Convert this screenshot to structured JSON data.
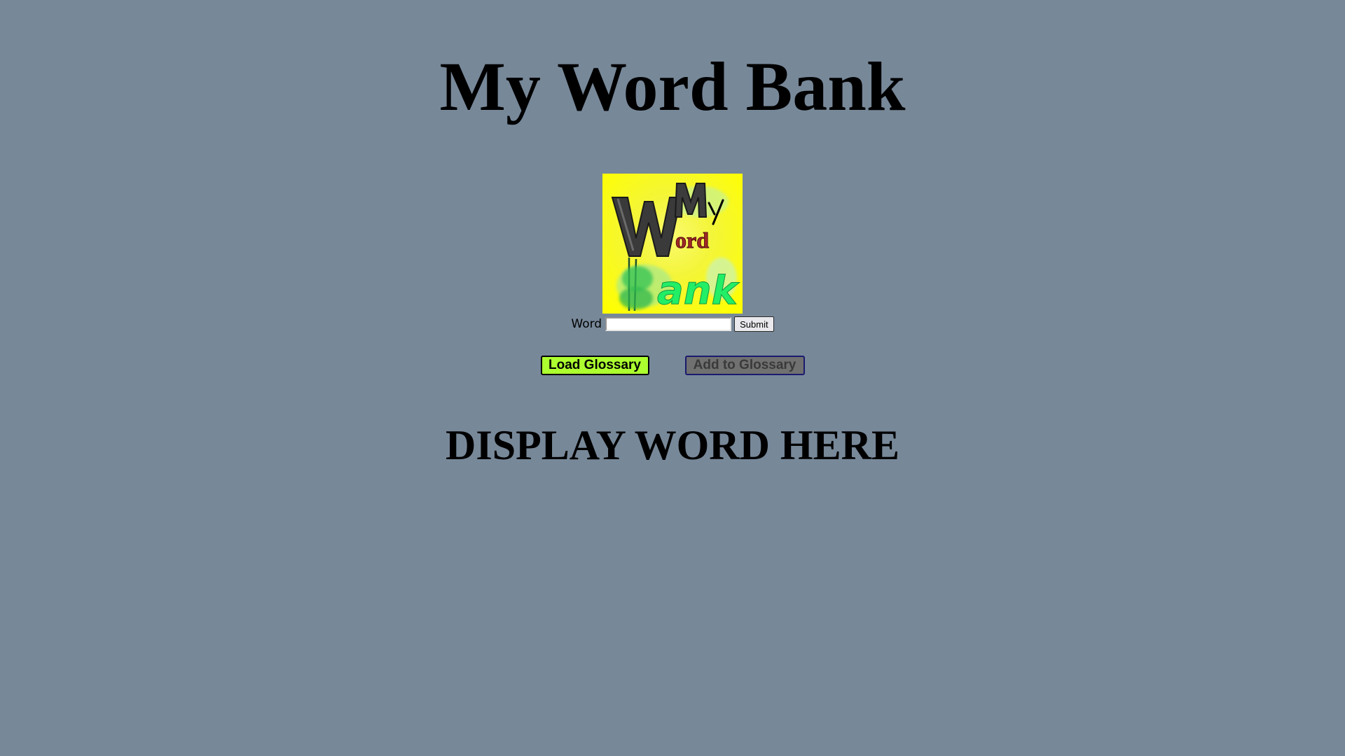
{
  "page": {
    "title": "My Word Bank",
    "background_color": "#778899"
  },
  "logo": {
    "icon": "word-bank-logo",
    "text": "My Word Bank",
    "colors": {
      "background": "#ffff22",
      "dark_letters": "#3a3a3a",
      "ord_letters": "#a02828",
      "bank_letters": "#22ee66"
    }
  },
  "form": {
    "word_label": "Word",
    "word_value": "",
    "word_placeholder": "",
    "submit_label": "Submit"
  },
  "actions": {
    "load_label": "Load Glossary",
    "load_color": "#adff2f",
    "add_label": "Add to Glossary",
    "add_color": "#707070"
  },
  "output": {
    "display_text": "DISPLAY WORD HERE"
  }
}
